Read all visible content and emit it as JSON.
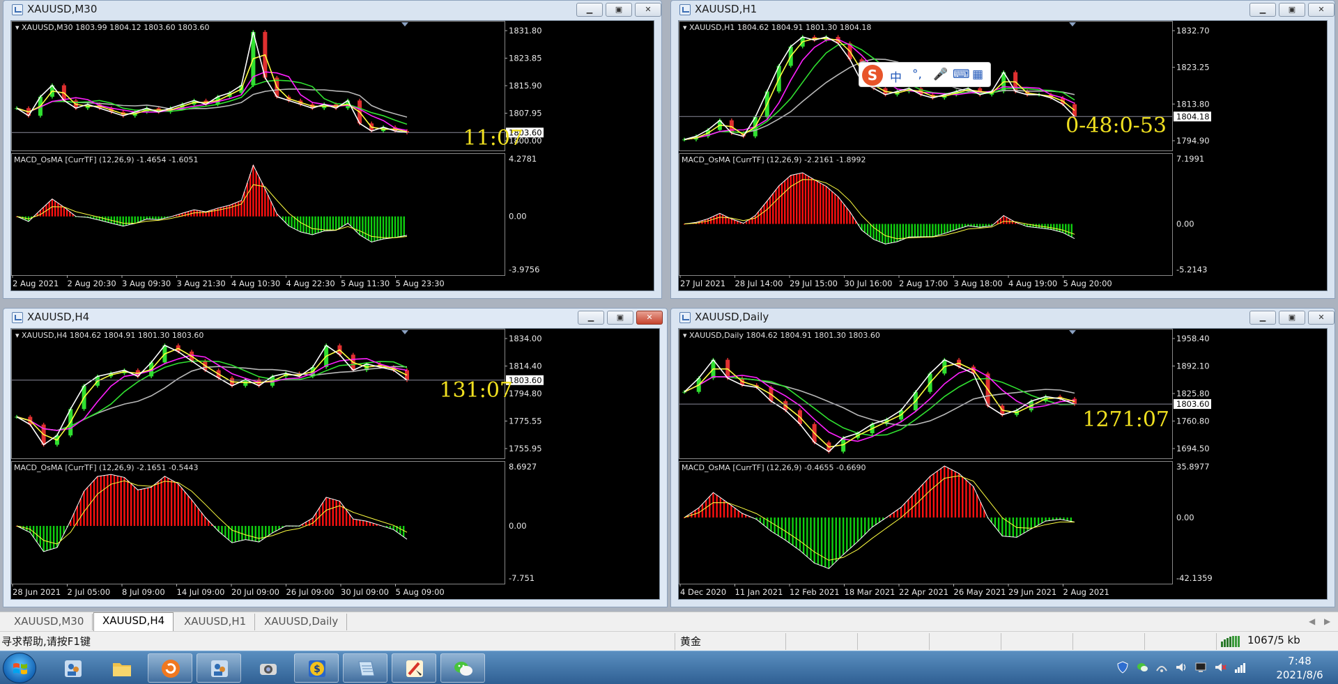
{
  "windows": {
    "m30": {
      "title": "XAUUSD,M30",
      "info": "XAUUSD,M30  1803.99 1804.12 1803.60 1803.60",
      "macd_info": "MACD_OsMA [CurrTF] (12,26,9) -1.4654 -1.6051",
      "price_ticks": [
        "1831.80",
        "1823.85",
        "1815.90",
        "1807.95",
        "1800.00"
      ],
      "current_price": "1803.60",
      "macd_ticks": [
        "4.2781",
        "0.00",
        "-3.9756"
      ],
      "time_ticks": [
        "2 Aug 2021",
        "2 Aug 20:30",
        "3 Aug 09:30",
        "3 Aug 21:30",
        "4 Aug 10:30",
        "4 Aug 22:30",
        "5 Aug 11:30",
        "5 Aug 23:30"
      ],
      "timer": "11:07"
    },
    "h1": {
      "title": "XAUUSD,H1",
      "info": "XAUUSD,H1  1804.62 1804.91 1801.30 1804.18",
      "macd_info": "MACD_OsMA [CurrTF] (12,26,9) -2.2161 -1.8992",
      "price_ticks": [
        "1832.70",
        "1823.25",
        "1813.80",
        "1794.90"
      ],
      "current_price": "1804.18",
      "macd_ticks": [
        "7.1991",
        "0.00",
        "-5.2143"
      ],
      "time_ticks": [
        "27 Jul 2021",
        "28 Jul 14:00",
        "29 Jul 15:00",
        "30 Jul 16:00",
        "2 Aug 17:00",
        "3 Aug 18:00",
        "4 Aug 19:00",
        "5 Aug 20:00"
      ],
      "timer": "0-48:0-53"
    },
    "h4": {
      "title": "XAUUSD,H4",
      "info": "XAUUSD,H4  1804.62 1804.91 1801.30 1803.60",
      "macd_info": "MACD_OsMA [CurrTF] (12,26,9) -2.1651 -0.5443",
      "price_ticks": [
        "1834.00",
        "1814.40",
        "1794.80",
        "1775.55",
        "1755.95"
      ],
      "current_price": "1803.60",
      "macd_ticks": [
        "8.6927",
        "0.00",
        "-7.751"
      ],
      "time_ticks": [
        "28 Jun 2021",
        "2 Jul 05:00",
        "8 Jul 09:00",
        "14 Jul 09:00",
        "20 Jul 09:00",
        "26 Jul 09:00",
        "30 Jul 09:00",
        "5 Aug 09:00"
      ],
      "timer": "131:07"
    },
    "daily": {
      "title": "XAUUSD,Daily",
      "info": "XAUUSD,Daily  1804.62 1804.91 1801.30 1803.60",
      "macd_info": "MACD_OsMA [CurrTF] (12,26,9) -0.4655 -0.6690",
      "price_ticks": [
        "1958.40",
        "1892.10",
        "1825.80",
        "1760.80",
        "1694.50"
      ],
      "current_price": "1803.60",
      "macd_ticks": [
        "35.8977",
        "0.00",
        "-42.1359"
      ],
      "time_ticks": [
        "4 Dec 2020",
        "11 Jan 2021",
        "12 Feb 2021",
        "18 Mar 2021",
        "22 Apr 2021",
        "26 May 2021",
        "29 Jun 2021",
        "2 Aug 2021"
      ],
      "timer": "1271:07"
    }
  },
  "ime": {
    "logo": "S",
    "items": [
      "中",
      "°,",
      "🎤",
      "⌨",
      "▦"
    ]
  },
  "tabs": [
    "XAUUSD,M30",
    "XAUUSD,H4",
    "XAUUSD,H1",
    "XAUUSD,Daily"
  ],
  "active_tab": 1,
  "status": {
    "help": "寻求帮助,请按F1键",
    "symbol_name": "黄金",
    "traffic": "1067/5 kb"
  },
  "clock": {
    "time": "7:48",
    "date": "2021/8/6"
  },
  "colors": {
    "bull_hist": "#ff1010",
    "bear_hist": "#10d010",
    "ma_yellow": "#ffff40",
    "ma_magenta": "#ff20ff",
    "ma_green": "#30e030",
    "ma_gray": "#b8b8b8",
    "timer": "#f0e020"
  },
  "chart_data": [
    {
      "type": "line",
      "title": "XAUUSD,M30",
      "ylim": [
        1800.0,
        1831.8
      ],
      "macd_ylim": [
        -3.9756,
        4.2781
      ],
      "last_price": 1803.6,
      "close": [
        1810,
        1808,
        1813,
        1816,
        1812,
        1810,
        1811,
        1810,
        1809,
        1808,
        1809,
        1810,
        1809,
        1810,
        1811,
        1812,
        1811,
        1813,
        1814,
        1816,
        1830,
        1818,
        1813,
        1812,
        1811,
        1810,
        1811,
        1810,
        1812,
        1806,
        1804,
        1805,
        1804,
        1803.6
      ]
    },
    {
      "type": "line",
      "title": "XAUUSD,H1",
      "ylim": [
        1794.9,
        1832.7
      ],
      "macd_ylim": [
        -5.2143,
        7.1991
      ],
      "last_price": 1804.18,
      "close": [
        1797,
        1798,
        1800,
        1803,
        1799,
        1798,
        1804,
        1812,
        1820,
        1826,
        1829,
        1828,
        1829,
        1827,
        1822,
        1815,
        1813,
        1811,
        1812,
        1813,
        1811,
        1810,
        1811,
        1812,
        1813,
        1811,
        1812,
        1818,
        1812,
        1811,
        1811,
        1810,
        1808,
        1804.18
      ]
    },
    {
      "type": "line",
      "title": "XAUUSD,H4",
      "ylim": [
        1755.95,
        1834.0
      ],
      "macd_ylim": [
        -7.751,
        8.6927
      ],
      "last_price": 1803.6,
      "close": [
        1780,
        1775,
        1762,
        1768,
        1785,
        1800,
        1806,
        1808,
        1810,
        1806,
        1815,
        1826,
        1822,
        1816,
        1810,
        1805,
        1800,
        1804,
        1800,
        1806,
        1808,
        1806,
        1812,
        1826,
        1820,
        1810,
        1814,
        1812,
        1810,
        1803.6
      ]
    },
    {
      "type": "line",
      "title": "XAUUSD,Daily",
      "ylim": [
        1694.5,
        1958.4
      ],
      "macd_ylim": [
        -42.1359,
        35.8977
      ],
      "last_price": 1803.6,
      "close": [
        1830,
        1860,
        1900,
        1860,
        1845,
        1840,
        1810,
        1790,
        1760,
        1720,
        1700,
        1730,
        1740,
        1760,
        1770,
        1790,
        1830,
        1870,
        1900,
        1885,
        1870,
        1800,
        1780,
        1790,
        1810,
        1820,
        1815,
        1803.6
      ]
    }
  ]
}
